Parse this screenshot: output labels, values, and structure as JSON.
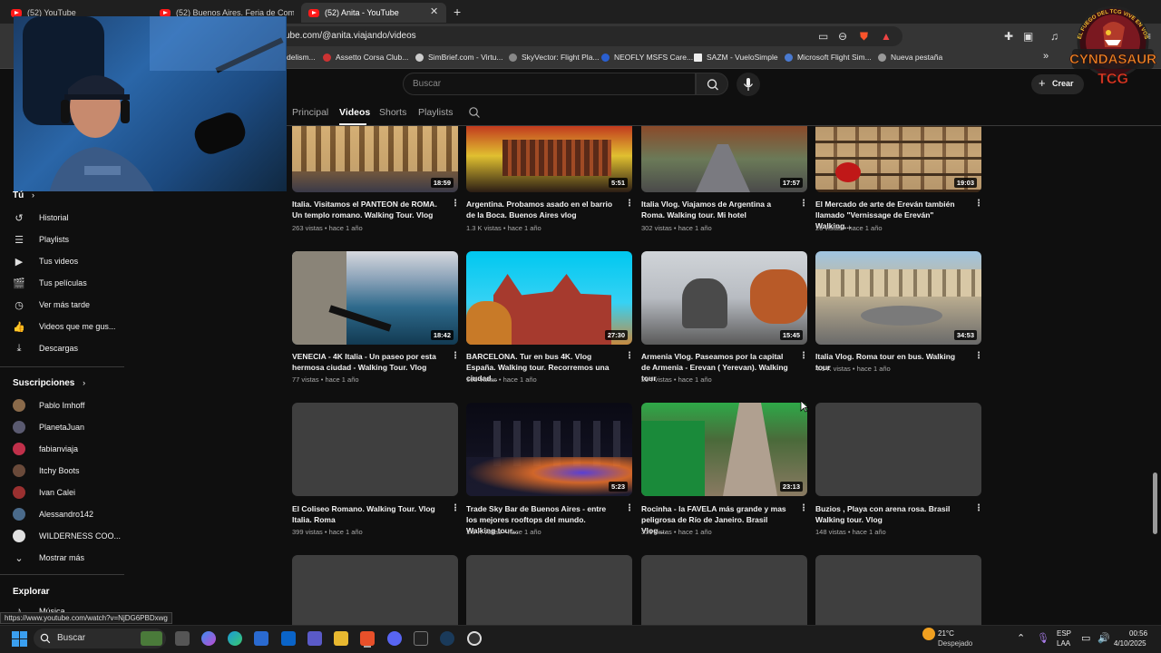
{
  "browser": {
    "tabs": [
      {
        "title": "(52) YouTube"
      },
      {
        "title": "(52) Buenos Aires. Feria de Comida C"
      },
      {
        "title": "(52) Anita - YouTube",
        "active": true
      }
    ],
    "close_glyph": "✕",
    "new_tab_glyph": "+",
    "url": "ube.com/@anita.viajando/videos",
    "bookmarks": [
      "delism...",
      "Assetto Corsa Club...",
      "SimBrief.com - Virtu...",
      "SkyVector: Flight Pla...",
      "NEOFLY MSFS Care...",
      "SAZM - VueloSimple",
      "Microsoft Flight Sim...",
      "Nueva pestaña"
    ],
    "bookmarks_more": "»",
    "status_url": "https://www.youtube.com/watch?v=NjDG6PBDxwg"
  },
  "youtube": {
    "search_placeholder": "Buscar",
    "create_label": "Crear",
    "channel_tabs": [
      "Principal",
      "Videos",
      "Shorts",
      "Playlists"
    ],
    "active_tab": "Videos"
  },
  "overlay": {
    "logo_top": "EL FUEGO DEL TCG VIVE EN VOS",
    "logo_name": "CYNDASAUR",
    "logo_sub": "TCG"
  },
  "sidebar": {
    "you_label": "Tú",
    "items": [
      {
        "label": "Historial",
        "icon": "history-icon"
      },
      {
        "label": "Playlists",
        "icon": "playlists-icon"
      },
      {
        "label": "Tus videos",
        "icon": "your-videos-icon"
      },
      {
        "label": "Tus películas",
        "icon": "movies-icon"
      },
      {
        "label": "Ver más tarde",
        "icon": "watch-later-icon"
      },
      {
        "label": "Videos que me gus...",
        "icon": "like-icon"
      },
      {
        "label": "Descargas",
        "icon": "download-icon"
      }
    ],
    "subscriptions_label": "Suscripciones",
    "subscriptions": [
      {
        "name": "Pablo Imhoff",
        "color": "#8a6a4a"
      },
      {
        "name": "PlanetaJuan",
        "color": "#5a5a70"
      },
      {
        "name": "fabianviaja",
        "color": "#c0304a"
      },
      {
        "name": "Itchy Boots",
        "color": "#6a4a3a"
      },
      {
        "name": "Ivan Calei",
        "color": "#9a3030"
      },
      {
        "name": "Alessandro142",
        "color": "#4a6a8a"
      },
      {
        "name": "WILDERNESS COO...",
        "color": "#e0e0e0"
      }
    ],
    "show_more": "Mostrar más",
    "explore_label": "Explorar",
    "explore_first": "Música"
  },
  "videos": [
    {
      "title": "Italia. Visitamos el PANTEON de ROMA. Un templo romano. Walking Tour. Vlog",
      "views": "263 vistas",
      "age": "hace 1 año",
      "duration": "18:59"
    },
    {
      "title": "Argentina. Probamos asado en el barrio de la Boca. Buenos Aires vlog",
      "views": "1.3 K vistas",
      "age": "hace 1 año",
      "duration": "5:51"
    },
    {
      "title": "Italia Vlog. Viajamos de Argentina a Roma. Walking tour. Mi hotel",
      "views": "302 vistas",
      "age": "hace 1 año",
      "duration": "17:57"
    },
    {
      "title": "El Mercado de arte de Ereván también llamado \"Vernissage de Ereván\" Walking...",
      "views": "26 vistas",
      "age": "hace 1 año",
      "duration": "19:03"
    },
    {
      "title": "VENECIA - 4K Italia - Un paseo por esta hermosa ciudad - Walking Tour. Vlog",
      "views": "77 vistas",
      "age": "hace 1 año",
      "duration": "18:42"
    },
    {
      "title": "BARCELONA. Tur en bus 4K. Vlog España. Walking tour. Recorremos una ciudad...",
      "views": "165 vistas",
      "age": "hace 1 año",
      "duration": "27:30"
    },
    {
      "title": "Armenia Vlog. Paseamos por la capital de Armenia - Erevan ( Yerevan). Walking tour",
      "views": "294 vistas",
      "age": "hace 1 año",
      "duration": "15:45"
    },
    {
      "title": "Italia Vlog. Roma tour en bus. Walking tour",
      "views": "4.1 K vistas",
      "age": "hace 1 año",
      "duration": "34:53"
    },
    {
      "title": "El Coliseo Romano. Walking Tour. Vlog Italia. Roma",
      "views": "399 vistas",
      "age": "hace 1 año",
      "duration": ""
    },
    {
      "title": "Trade Sky Bar de Buenos Aires - entre los mejores rooftops del mundo. Walking tour...",
      "views": "1.5 K vistas",
      "age": "hace 1 año",
      "duration": "5:23"
    },
    {
      "title": "Rocinha - la FAVELA más grande y mas peligrosa de Río de Janeiro. Brasil Vlog....",
      "views": "331 vistas",
      "age": "hace 1 año",
      "duration": "23:13"
    },
    {
      "title": "Buzios , Playa con arena rosa. Brasil Walking tour. Vlog",
      "views": "148 vistas",
      "age": "hace 1 año",
      "duration": ""
    }
  ],
  "meta_sep": "•",
  "taskbar": {
    "search_label": "Buscar",
    "weather_temp": "21°C",
    "weather_desc": "Despejado",
    "lang_top": "ESP",
    "lang_bottom": "LAA",
    "time": "00:56",
    "date": "4/10/2025"
  }
}
